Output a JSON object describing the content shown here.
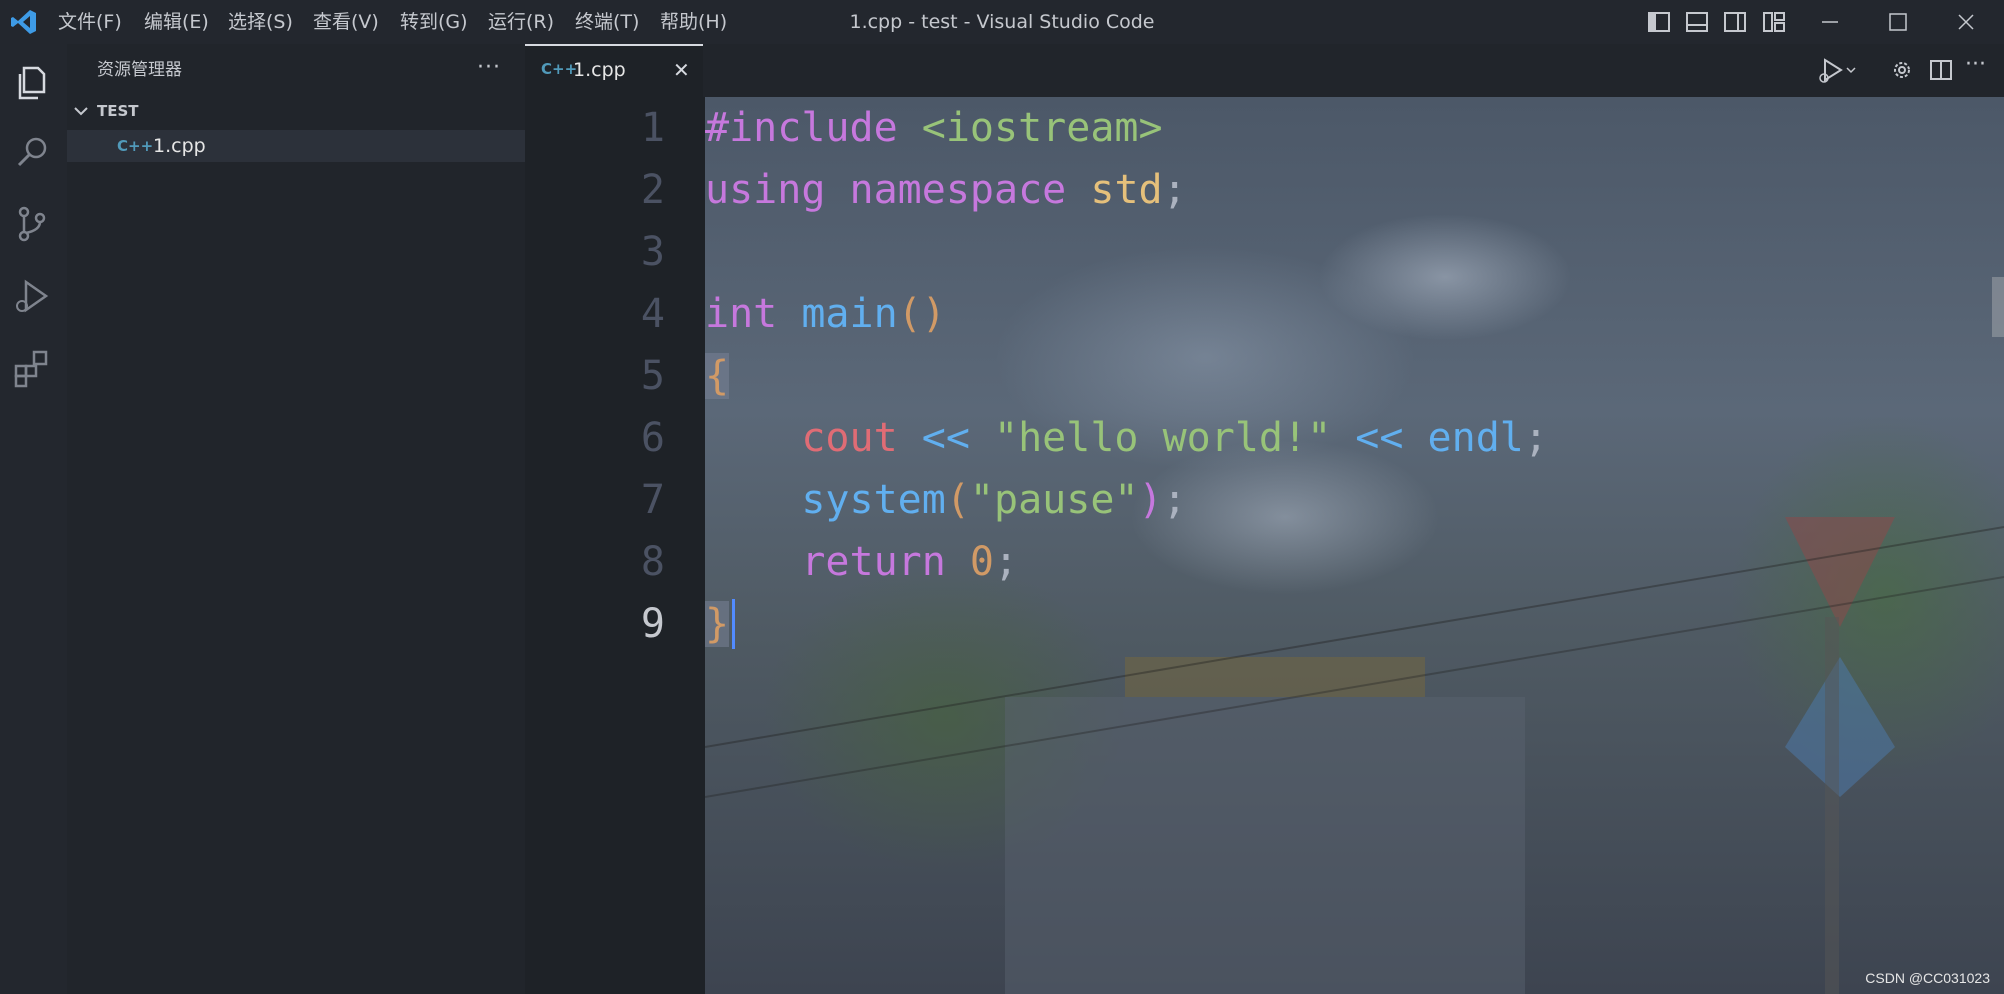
{
  "titlebar": {
    "menus": [
      "文件(F)",
      "编辑(E)",
      "选择(S)",
      "查看(V)",
      "转到(G)",
      "运行(R)",
      "终端(T)",
      "帮助(H)"
    ],
    "window_title": "1.cpp - test - Visual Studio Code"
  },
  "sidebar": {
    "title": "资源管理器",
    "more": "···",
    "folder": "TEST",
    "files": [
      {
        "name": "1.cpp",
        "icon": "cpp-file-icon"
      }
    ]
  },
  "tabs": [
    {
      "label": "1.cpp",
      "icon": "cpp-file-icon",
      "close": "✕"
    }
  ],
  "editor": {
    "line_numbers": [
      "1",
      "2",
      "3",
      "4",
      "5",
      "6",
      "7",
      "8",
      "9"
    ],
    "active_line": 9,
    "code": {
      "l1_directive": "#include",
      "l1_header": "<iostream>",
      "l2_using": "using",
      "l2_namespace": "namespace",
      "l2_std": "std",
      "l2_semi": ";",
      "l4_int": "int",
      "l4_main": "main",
      "l4_parens": "()",
      "l5_open": "{",
      "l6_indent": "    ",
      "l6_cout": "cout",
      "l6_op1": "<<",
      "l6_string": "\"hello world!\"",
      "l6_op2": "<<",
      "l6_endl": "endl",
      "l6_semi": ";",
      "l7_system": "system",
      "l7_open": "(",
      "l7_string": "\"pause\"",
      "l7_close": ")",
      "l7_semi": ";",
      "l8_return": "return",
      "l8_zero": "0",
      "l8_semi": ";",
      "l9_close": "}"
    }
  },
  "watermark": "CSDN @CC031023",
  "colors": {
    "keyword": "#c678dd",
    "string": "#98c379",
    "type": "#e5c07b",
    "function": "#61afef",
    "variable": "#e06c75",
    "number": "#d19a66",
    "vscode_blue": "#3e9be6"
  }
}
